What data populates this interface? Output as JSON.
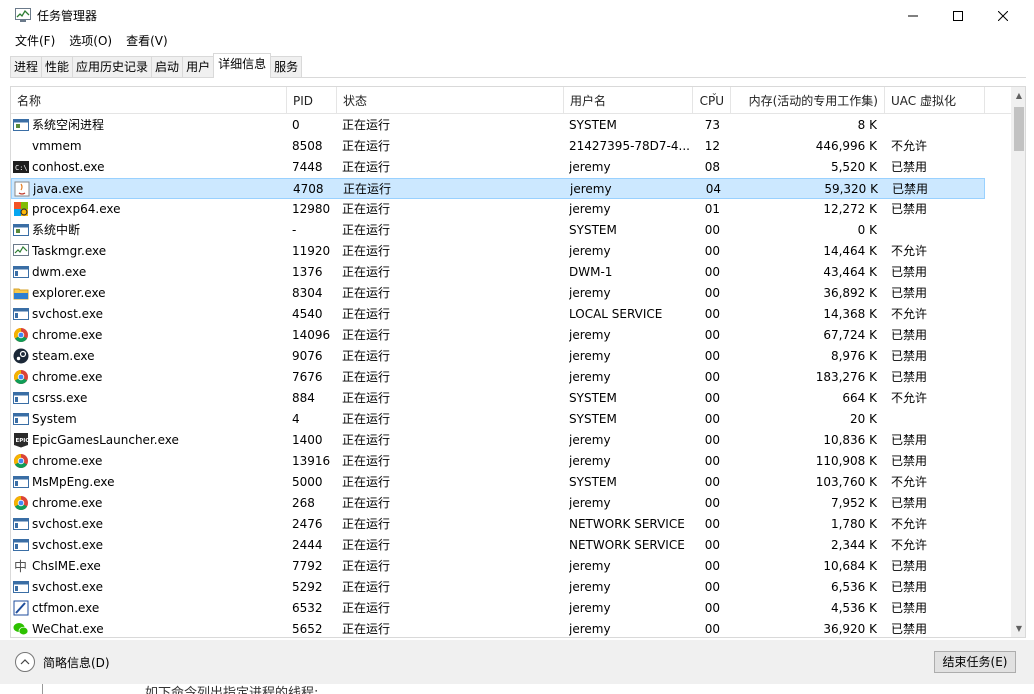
{
  "window": {
    "title": "任务管理器"
  },
  "menu": [
    "文件(F)",
    "选项(O)",
    "查看(V)"
  ],
  "tabs": [
    "进程",
    "性能",
    "应用历史记录",
    "启动",
    "用户",
    "详细信息",
    "服务"
  ],
  "active_tab": "详细信息",
  "columns": {
    "name": "名称",
    "pid": "PID",
    "status": "状态",
    "user": "用户名",
    "cpu": "CPU",
    "memory": "内存(活动的专用工作集)",
    "uac": "UAC 虚拟化"
  },
  "sort": {
    "column": "CPU",
    "direction": "descending"
  },
  "rows": [
    {
      "name": "系统空闲进程",
      "pid": "0",
      "status": "正在运行",
      "user": "SYSTEM",
      "cpu": "73",
      "mem": "8 K",
      "uac": "",
      "icon": "system-icon"
    },
    {
      "name": "vmmem",
      "pid": "8508",
      "status": "正在运行",
      "user": "21427395-78D7-4...",
      "cpu": "12",
      "mem": "446,996 K",
      "uac": "不允许",
      "icon": "blank-icon"
    },
    {
      "name": "conhost.exe",
      "pid": "7448",
      "status": "正在运行",
      "user": "jeremy",
      "cpu": "08",
      "mem": "5,520 K",
      "uac": "已禁用",
      "icon": "console-icon"
    },
    {
      "name": "java.exe",
      "pid": "4708",
      "status": "正在运行",
      "user": "jeremy",
      "cpu": "04",
      "mem": "59,320 K",
      "uac": "已禁用",
      "icon": "java-icon",
      "selected": true
    },
    {
      "name": "procexp64.exe",
      "pid": "12980",
      "status": "正在运行",
      "user": "jeremy",
      "cpu": "01",
      "mem": "12,272 K",
      "uac": "已禁用",
      "icon": "procexp-icon"
    },
    {
      "name": "系统中断",
      "pid": "-",
      "status": "正在运行",
      "user": "SYSTEM",
      "cpu": "00",
      "mem": "0 K",
      "uac": "",
      "icon": "system-icon"
    },
    {
      "name": "Taskmgr.exe",
      "pid": "11920",
      "status": "正在运行",
      "user": "jeremy",
      "cpu": "00",
      "mem": "14,464 K",
      "uac": "不允许",
      "icon": "taskmgr-icon"
    },
    {
      "name": "dwm.exe",
      "pid": "1376",
      "status": "正在运行",
      "user": "DWM-1",
      "cpu": "00",
      "mem": "43,464 K",
      "uac": "已禁用",
      "icon": "window-icon"
    },
    {
      "name": "explorer.exe",
      "pid": "8304",
      "status": "正在运行",
      "user": "jeremy",
      "cpu": "00",
      "mem": "36,892 K",
      "uac": "已禁用",
      "icon": "folder-icon"
    },
    {
      "name": "svchost.exe",
      "pid": "4540",
      "status": "正在运行",
      "user": "LOCAL SERVICE",
      "cpu": "00",
      "mem": "14,368 K",
      "uac": "不允许",
      "icon": "window-icon"
    },
    {
      "name": "chrome.exe",
      "pid": "14096",
      "status": "正在运行",
      "user": "jeremy",
      "cpu": "00",
      "mem": "67,724 K",
      "uac": "已禁用",
      "icon": "chrome-icon"
    },
    {
      "name": "steam.exe",
      "pid": "9076",
      "status": "正在运行",
      "user": "jeremy",
      "cpu": "00",
      "mem": "8,976 K",
      "uac": "已禁用",
      "icon": "steam-icon"
    },
    {
      "name": "chrome.exe",
      "pid": "7676",
      "status": "正在运行",
      "user": "jeremy",
      "cpu": "00",
      "mem": "183,276 K",
      "uac": "已禁用",
      "icon": "chrome-icon"
    },
    {
      "name": "csrss.exe",
      "pid": "884",
      "status": "正在运行",
      "user": "SYSTEM",
      "cpu": "00",
      "mem": "664 K",
      "uac": "不允许",
      "icon": "window-icon"
    },
    {
      "name": "System",
      "pid": "4",
      "status": "正在运行",
      "user": "SYSTEM",
      "cpu": "00",
      "mem": "20 K",
      "uac": "",
      "icon": "window-icon"
    },
    {
      "name": "EpicGamesLauncher.exe",
      "pid": "1400",
      "status": "正在运行",
      "user": "jeremy",
      "cpu": "00",
      "mem": "10,836 K",
      "uac": "已禁用",
      "icon": "epic-icon"
    },
    {
      "name": "chrome.exe",
      "pid": "13916",
      "status": "正在运行",
      "user": "jeremy",
      "cpu": "00",
      "mem": "110,908 K",
      "uac": "已禁用",
      "icon": "chrome-icon"
    },
    {
      "name": "MsMpEng.exe",
      "pid": "5000",
      "status": "正在运行",
      "user": "SYSTEM",
      "cpu": "00",
      "mem": "103,760 K",
      "uac": "不允许",
      "icon": "window-icon"
    },
    {
      "name": "chrome.exe",
      "pid": "268",
      "status": "正在运行",
      "user": "jeremy",
      "cpu": "00",
      "mem": "7,952 K",
      "uac": "已禁用",
      "icon": "chrome-icon"
    },
    {
      "name": "svchost.exe",
      "pid": "2476",
      "status": "正在运行",
      "user": "NETWORK SERVICE",
      "cpu": "00",
      "mem": "1,780 K",
      "uac": "不允许",
      "icon": "window-icon"
    },
    {
      "name": "svchost.exe",
      "pid": "2444",
      "status": "正在运行",
      "user": "NETWORK SERVICE",
      "cpu": "00",
      "mem": "2,344 K",
      "uac": "不允许",
      "icon": "window-icon"
    },
    {
      "name": "ChsIME.exe",
      "pid": "7792",
      "status": "正在运行",
      "user": "jeremy",
      "cpu": "00",
      "mem": "10,684 K",
      "uac": "已禁用",
      "icon": "ime-icon"
    },
    {
      "name": "svchost.exe",
      "pid": "5292",
      "status": "正在运行",
      "user": "jeremy",
      "cpu": "00",
      "mem": "6,536 K",
      "uac": "已禁用",
      "icon": "window-icon"
    },
    {
      "name": "ctfmon.exe",
      "pid": "6532",
      "status": "正在运行",
      "user": "jeremy",
      "cpu": "00",
      "mem": "4,536 K",
      "uac": "已禁用",
      "icon": "ctfmon-icon"
    },
    {
      "name": "WeChat.exe",
      "pid": "5652",
      "status": "正在运行",
      "user": "jeremy",
      "cpu": "00",
      "mem": "36,920 K",
      "uac": "已禁用",
      "icon": "wechat-icon"
    }
  ],
  "footer": {
    "fewer_details": "简略信息(D)",
    "end_task": "结束任务(E)"
  },
  "background_text": "如下命令列出指定进程的线程:",
  "colors": {
    "selection_bg": "#cce8ff",
    "selection_border": "#99d1ff",
    "footer_bg": "#f0f0f0"
  }
}
